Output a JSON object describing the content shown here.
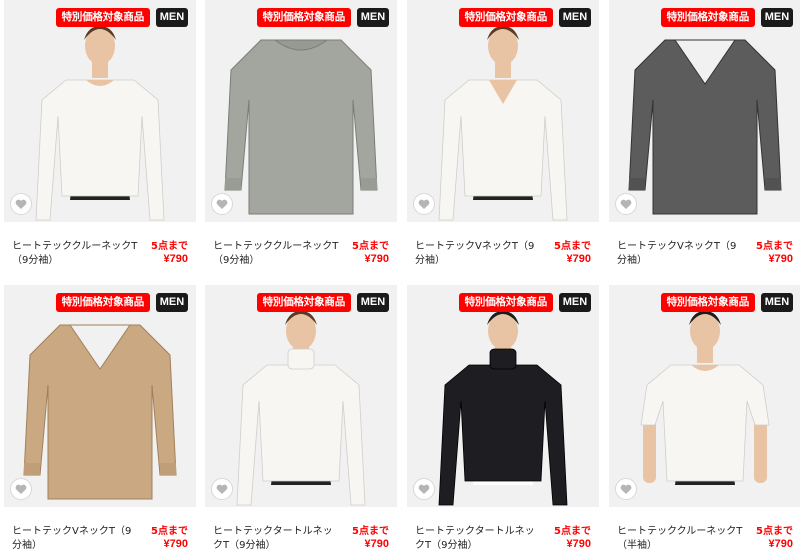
{
  "products": [
    {
      "sale_badge": "特別価格対象商品",
      "gender_badge": "MEN",
      "name": "ヒートテッククルーネックT（9分袖）",
      "limit": "5点まで",
      "price": "¥790",
      "color": "#f7f6f2",
      "style": "crew-model"
    },
    {
      "sale_badge": "特別価格対象商品",
      "gender_badge": "MEN",
      "name": "ヒートテッククルーネックT（9分袖）",
      "limit": "5点まで",
      "price": "¥790",
      "color": "#a3a59f",
      "style": "crew-flat"
    },
    {
      "sale_badge": "特別価格対象商品",
      "gender_badge": "MEN",
      "name": "ヒートテックVネックT（9分袖）",
      "limit": "5点まで",
      "price": "¥790",
      "color": "#f7f6f2",
      "style": "v-model"
    },
    {
      "sale_badge": "特別価格対象商品",
      "gender_badge": "MEN",
      "name": "ヒートテックVネックT（9分袖）",
      "limit": "5点まで",
      "price": "¥790",
      "color": "#5c5c5c",
      "style": "v-flat"
    },
    {
      "sale_badge": "特別価格対象商品",
      "gender_badge": "MEN",
      "name": "ヒートテックVネックT（9分袖）",
      "limit": "5点まで",
      "price": "¥790",
      "color": "#c9a882",
      "style": "v-flat"
    },
    {
      "sale_badge": "特別価格対象商品",
      "gender_badge": "MEN",
      "name": "ヒートテックタートルネックT（9分袖）",
      "limit": "5点まで",
      "price": "¥790",
      "color": "#f7f6f2",
      "style": "turtle-model"
    },
    {
      "sale_badge": "特別価格対象商品",
      "gender_badge": "MEN",
      "name": "ヒートテックタートルネックT（9分袖）",
      "limit": "5点まで",
      "price": "¥790",
      "color": "#1d1d22",
      "style": "turtle-model-white-pants"
    },
    {
      "sale_badge": "特別価格対象商品",
      "gender_badge": "MEN",
      "name": "ヒートテッククルーネックT（半袖）",
      "limit": "5点まで",
      "price": "¥790",
      "color": "#f7f6f2",
      "style": "short-model"
    }
  ],
  "icons": {
    "favorite": "heart-icon"
  }
}
